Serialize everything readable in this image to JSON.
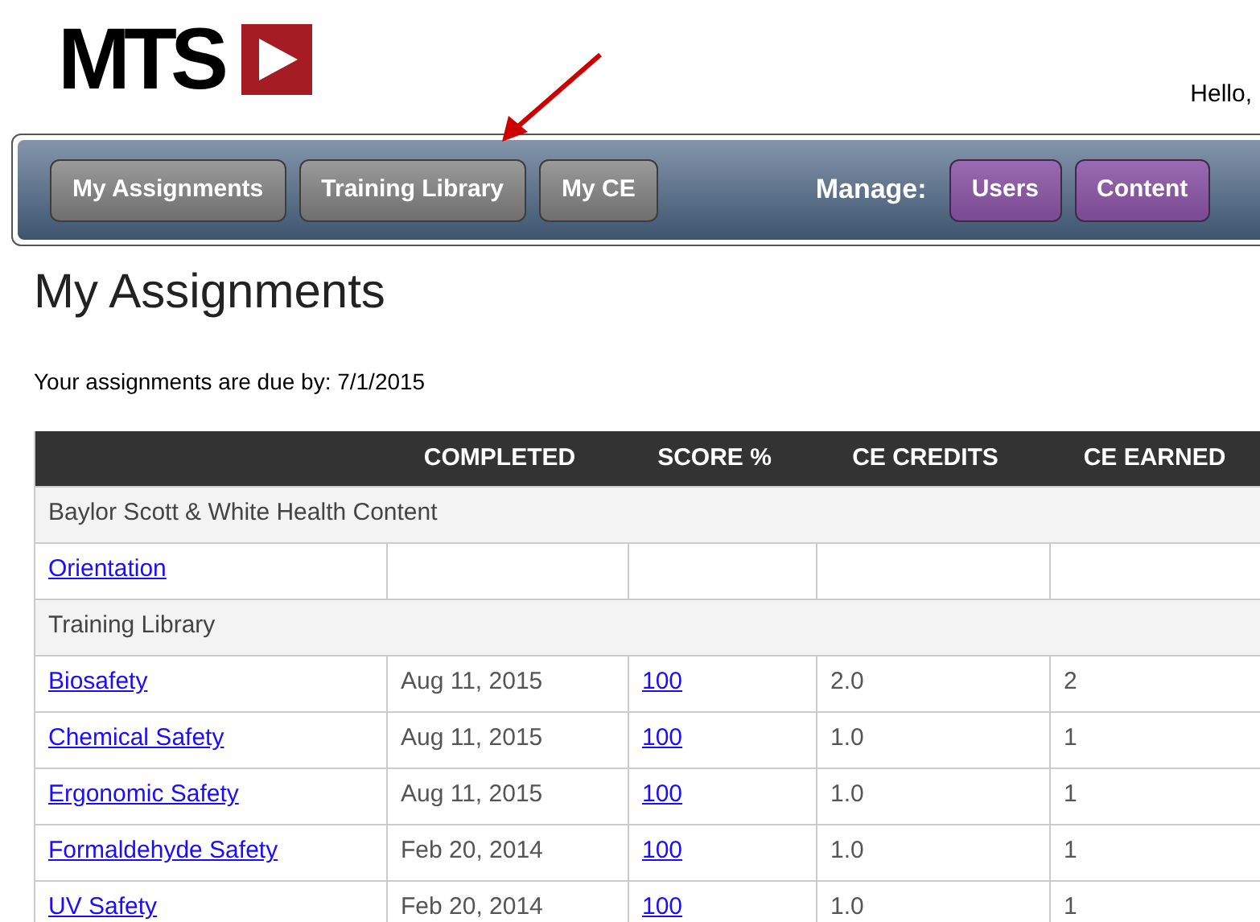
{
  "header": {
    "logo_text": "MTS",
    "greeting": "Hello,"
  },
  "nav": {
    "buttons": [
      {
        "label": "My Assignments",
        "kind": "nav"
      },
      {
        "label": "Training Library",
        "kind": "nav"
      },
      {
        "label": "My CE",
        "kind": "nav"
      }
    ],
    "manage_label": "Manage:",
    "manage_buttons": [
      {
        "label": "Users",
        "kind": "manage"
      },
      {
        "label": "Content",
        "kind": "manage"
      }
    ]
  },
  "title": "My Assignments",
  "due_text": "Your assignments are due by: 7/1/2015",
  "table": {
    "columns": [
      "COMPLETED",
      "SCORE %",
      "CE CREDITS",
      "CE EARNED"
    ],
    "rows": [
      {
        "kind": "group",
        "label": "Baylor Scott & White Health Content"
      },
      {
        "kind": "item",
        "name": "Orientation"
      },
      {
        "kind": "group",
        "label": "Training Library"
      },
      {
        "kind": "item",
        "name": "Biosafety",
        "completed": "Aug 11, 2015",
        "score": "100",
        "credits": "2.0",
        "earned": "2"
      },
      {
        "kind": "item",
        "name": "Chemical Safety",
        "completed": "Aug 11, 2015",
        "score": "100",
        "credits": "1.0",
        "earned": "1"
      },
      {
        "kind": "item",
        "name": "Ergonomic Safety",
        "completed": "Aug 11, 2015",
        "score": "100",
        "credits": "1.0",
        "earned": "1"
      },
      {
        "kind": "item",
        "name": "Formaldehyde Safety",
        "completed": "Feb 20, 2014",
        "score": "100",
        "credits": "1.0",
        "earned": "1"
      },
      {
        "kind": "item",
        "name": "UV Safety",
        "completed": "Feb 20, 2014",
        "score": "100",
        "credits": "1.0",
        "earned": "1"
      }
    ]
  }
}
